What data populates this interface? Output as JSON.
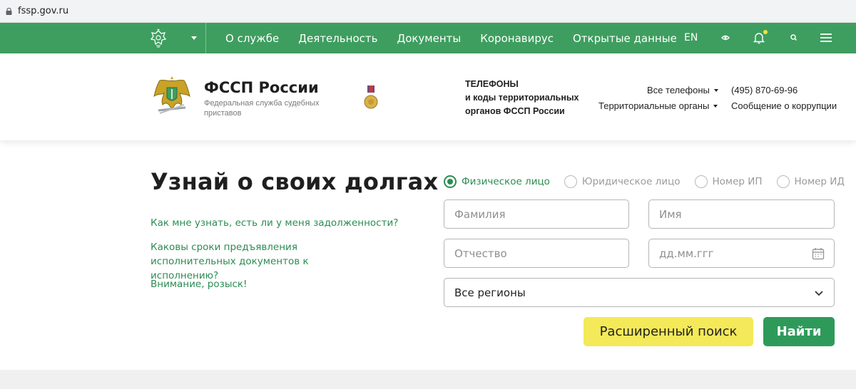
{
  "browser": {
    "url": "fssp.gov.ru"
  },
  "nav": {
    "menu": [
      "О службе",
      "Деятельность",
      "Документы",
      "Коронавирус",
      "Открытые данные"
    ],
    "lang": "EN",
    "icons": [
      "emblem-icon",
      "chevron-down-icon",
      "eye-icon",
      "bell-icon",
      "search-icon",
      "menu-icon"
    ],
    "color": "#3e9e5f",
    "notification_dot_color": "#f3e23a"
  },
  "header": {
    "title": "ФССП России",
    "subtitle": "Федеральная служба судебных приставов",
    "phones_heading": "ТЕЛЕФОНЫ\nи коды территориальных органов ФССП России",
    "all_phones": "Все телефоны",
    "territorial": "Территориальные органы",
    "phone": "(495) 870-69-96",
    "corruption": "Сообщение о коррупции"
  },
  "main": {
    "title": "Узнай о своих долгах",
    "links": [
      "Как мне узнать, есть ли у меня задолженности?",
      "Каковы сроки предъявления исполнительных документов к исполнению?",
      "Внимание, розыск!"
    ],
    "radios": [
      {
        "label": "Физическое лицо",
        "selected": true
      },
      {
        "label": "Юридическое лицо",
        "selected": false
      },
      {
        "label": "Номер ИП",
        "selected": false
      },
      {
        "label": "Номер ИД",
        "selected": false
      }
    ],
    "fields": {
      "surname_placeholder": "Фамилия",
      "name_placeholder": "Имя",
      "patronymic_placeholder": "Отчество",
      "date_placeholder": "дд.мм.ггг"
    },
    "region_select": "Все регионы",
    "advanced_search": "Расширенный поиск",
    "find": "Найти",
    "accent_color": "#2b8c52",
    "advanced_color": "#f4e958"
  }
}
